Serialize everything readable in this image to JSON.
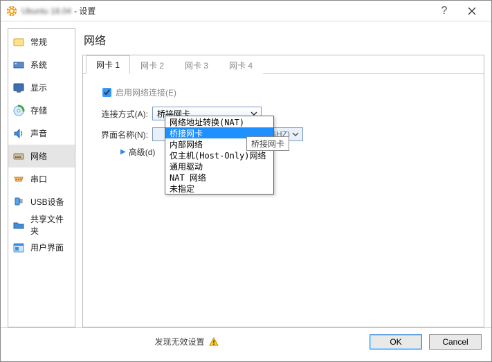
{
  "titlebar": {
    "obscured_text": "Ubuntu 18.04",
    "suffix": "- 设置"
  },
  "sidebar": {
    "items": [
      {
        "id": "general",
        "label": "常规"
      },
      {
        "id": "system",
        "label": "系统"
      },
      {
        "id": "display",
        "label": "显示"
      },
      {
        "id": "storage",
        "label": "存储"
      },
      {
        "id": "audio",
        "label": "声音"
      },
      {
        "id": "network",
        "label": "网络"
      },
      {
        "id": "serial",
        "label": "串口"
      },
      {
        "id": "usb",
        "label": "USB设备"
      },
      {
        "id": "shared",
        "label": "共享文件夹"
      },
      {
        "id": "ui",
        "label": "用户界面"
      }
    ],
    "selected": "network"
  },
  "main": {
    "page_title": "网络",
    "tabs": [
      "网卡 1",
      "网卡 2",
      "网卡 3",
      "网卡 4"
    ],
    "active_tab": 0,
    "form": {
      "enable_label": "启用网络连接(E)",
      "enable_checked": true,
      "attach_label": "连接方式(A):",
      "attach_value": "桥接网卡",
      "attach_options": [
        "网络地址转换(NAT)",
        "桥接网卡",
        "内部网络",
        "仅主机(Host-Only)网络",
        "通用驱动",
        "NAT 网络",
        "未指定"
      ],
      "attach_selected_index": 1,
      "tooltip": "桥接网卡",
      "name_label": "界面名称(N):",
      "name_value": "b/g/n (2.4GHZ)",
      "advanced_label": "高级(d)"
    }
  },
  "footer": {
    "status": "发现无效设置",
    "ok": "OK",
    "cancel": "Cancel"
  }
}
